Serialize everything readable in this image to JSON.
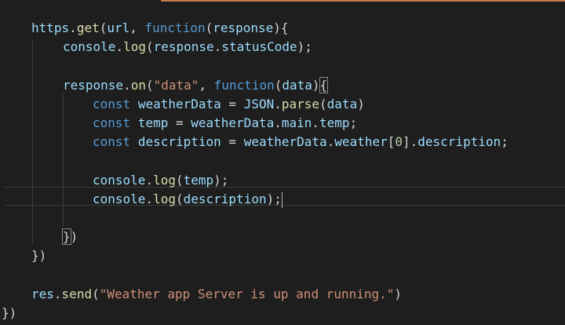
{
  "editor": {
    "lines": [
      {
        "indent": 40,
        "tokens": [
          {
            "t": "https",
            "c": "v"
          },
          {
            "t": ".",
            "c": "p"
          },
          {
            "t": "get",
            "c": "f"
          },
          {
            "t": "(",
            "c": "p"
          },
          {
            "t": "url",
            "c": "v"
          },
          {
            "t": ", ",
            "c": "p"
          },
          {
            "t": "function",
            "c": "k"
          },
          {
            "t": "(",
            "c": "p"
          },
          {
            "t": "response",
            "c": "v"
          },
          {
            "t": "){",
            "c": "p"
          }
        ]
      },
      {
        "indent": 80,
        "tokens": [
          {
            "t": "console",
            "c": "v"
          },
          {
            "t": ".",
            "c": "p"
          },
          {
            "t": "log",
            "c": "f"
          },
          {
            "t": "(",
            "c": "p"
          },
          {
            "t": "response",
            "c": "v"
          },
          {
            "t": ".",
            "c": "p"
          },
          {
            "t": "statusCode",
            "c": "v"
          },
          {
            "t": ");",
            "c": "p"
          }
        ]
      },
      {
        "indent": 0,
        "tokens": []
      },
      {
        "indent": 80,
        "tokens": [
          {
            "t": "response",
            "c": "v"
          },
          {
            "t": ".",
            "c": "p"
          },
          {
            "t": "on",
            "c": "f"
          },
          {
            "t": "(",
            "c": "p"
          },
          {
            "t": "\"data\"",
            "c": "s"
          },
          {
            "t": ", ",
            "c": "p"
          },
          {
            "t": "function",
            "c": "k"
          },
          {
            "t": "(",
            "c": "p"
          },
          {
            "t": "data",
            "c": "v"
          },
          {
            "t": ")",
            "c": "p"
          },
          {
            "t": "{",
            "c": "p",
            "box": true
          }
        ]
      },
      {
        "indent": 118,
        "tokens": [
          {
            "t": "const",
            "c": "k"
          },
          {
            "t": " ",
            "c": "p"
          },
          {
            "t": "weatherData",
            "c": "v"
          },
          {
            "t": " = ",
            "c": "p"
          },
          {
            "t": "JSON",
            "c": "v"
          },
          {
            "t": ".",
            "c": "p"
          },
          {
            "t": "parse",
            "c": "f"
          },
          {
            "t": "(",
            "c": "p"
          },
          {
            "t": "data",
            "c": "v"
          },
          {
            "t": ")",
            "c": "p"
          }
        ]
      },
      {
        "indent": 118,
        "tokens": [
          {
            "t": "const",
            "c": "k"
          },
          {
            "t": " ",
            "c": "p"
          },
          {
            "t": "temp",
            "c": "v"
          },
          {
            "t": " = ",
            "c": "p"
          },
          {
            "t": "weatherData",
            "c": "v"
          },
          {
            "t": ".",
            "c": "p"
          },
          {
            "t": "main",
            "c": "v"
          },
          {
            "t": ".",
            "c": "p"
          },
          {
            "t": "temp",
            "c": "v"
          },
          {
            "t": ";",
            "c": "p"
          }
        ]
      },
      {
        "indent": 118,
        "tokens": [
          {
            "t": "const",
            "c": "k"
          },
          {
            "t": " ",
            "c": "p"
          },
          {
            "t": "description",
            "c": "v"
          },
          {
            "t": " = ",
            "c": "p"
          },
          {
            "t": "weatherData",
            "c": "v"
          },
          {
            "t": ".",
            "c": "p"
          },
          {
            "t": "weather",
            "c": "v"
          },
          {
            "t": "[",
            "c": "p"
          },
          {
            "t": "0",
            "c": "n"
          },
          {
            "t": "].",
            "c": "p"
          },
          {
            "t": "description",
            "c": "v"
          },
          {
            "t": ";",
            "c": "p"
          }
        ]
      },
      {
        "indent": 0,
        "tokens": []
      },
      {
        "indent": 118,
        "tokens": [
          {
            "t": "console",
            "c": "v"
          },
          {
            "t": ".",
            "c": "p"
          },
          {
            "t": "log",
            "c": "f"
          },
          {
            "t": "(",
            "c": "p"
          },
          {
            "t": "temp",
            "c": "v"
          },
          {
            "t": ");",
            "c": "p"
          }
        ]
      },
      {
        "indent": 118,
        "cursor": true,
        "tokens": [
          {
            "t": "console",
            "c": "v"
          },
          {
            "t": ".",
            "c": "p"
          },
          {
            "t": "log",
            "c": "f"
          },
          {
            "t": "(",
            "c": "p"
          },
          {
            "t": "description",
            "c": "v"
          },
          {
            "t": ");",
            "c": "p"
          }
        ]
      },
      {
        "indent": 0,
        "tokens": []
      },
      {
        "indent": 80,
        "tokens": [
          {
            "t": "}",
            "c": "p",
            "box": true
          },
          {
            "t": ")",
            "c": "p"
          }
        ]
      },
      {
        "indent": 40,
        "tokens": [
          {
            "t": "})",
            "c": "p"
          }
        ]
      },
      {
        "indent": 0,
        "tokens": []
      },
      {
        "indent": 40,
        "tokens": [
          {
            "t": "res",
            "c": "v"
          },
          {
            "t": ".",
            "c": "p"
          },
          {
            "t": "send",
            "c": "f"
          },
          {
            "t": "(",
            "c": "p"
          },
          {
            "t": "\"Weather app Server is up and running.\"",
            "c": "s"
          },
          {
            "t": ")",
            "c": "p"
          }
        ]
      },
      {
        "indent": 2,
        "tokens": [
          {
            "t": "})",
            "c": "p"
          }
        ]
      }
    ]
  }
}
